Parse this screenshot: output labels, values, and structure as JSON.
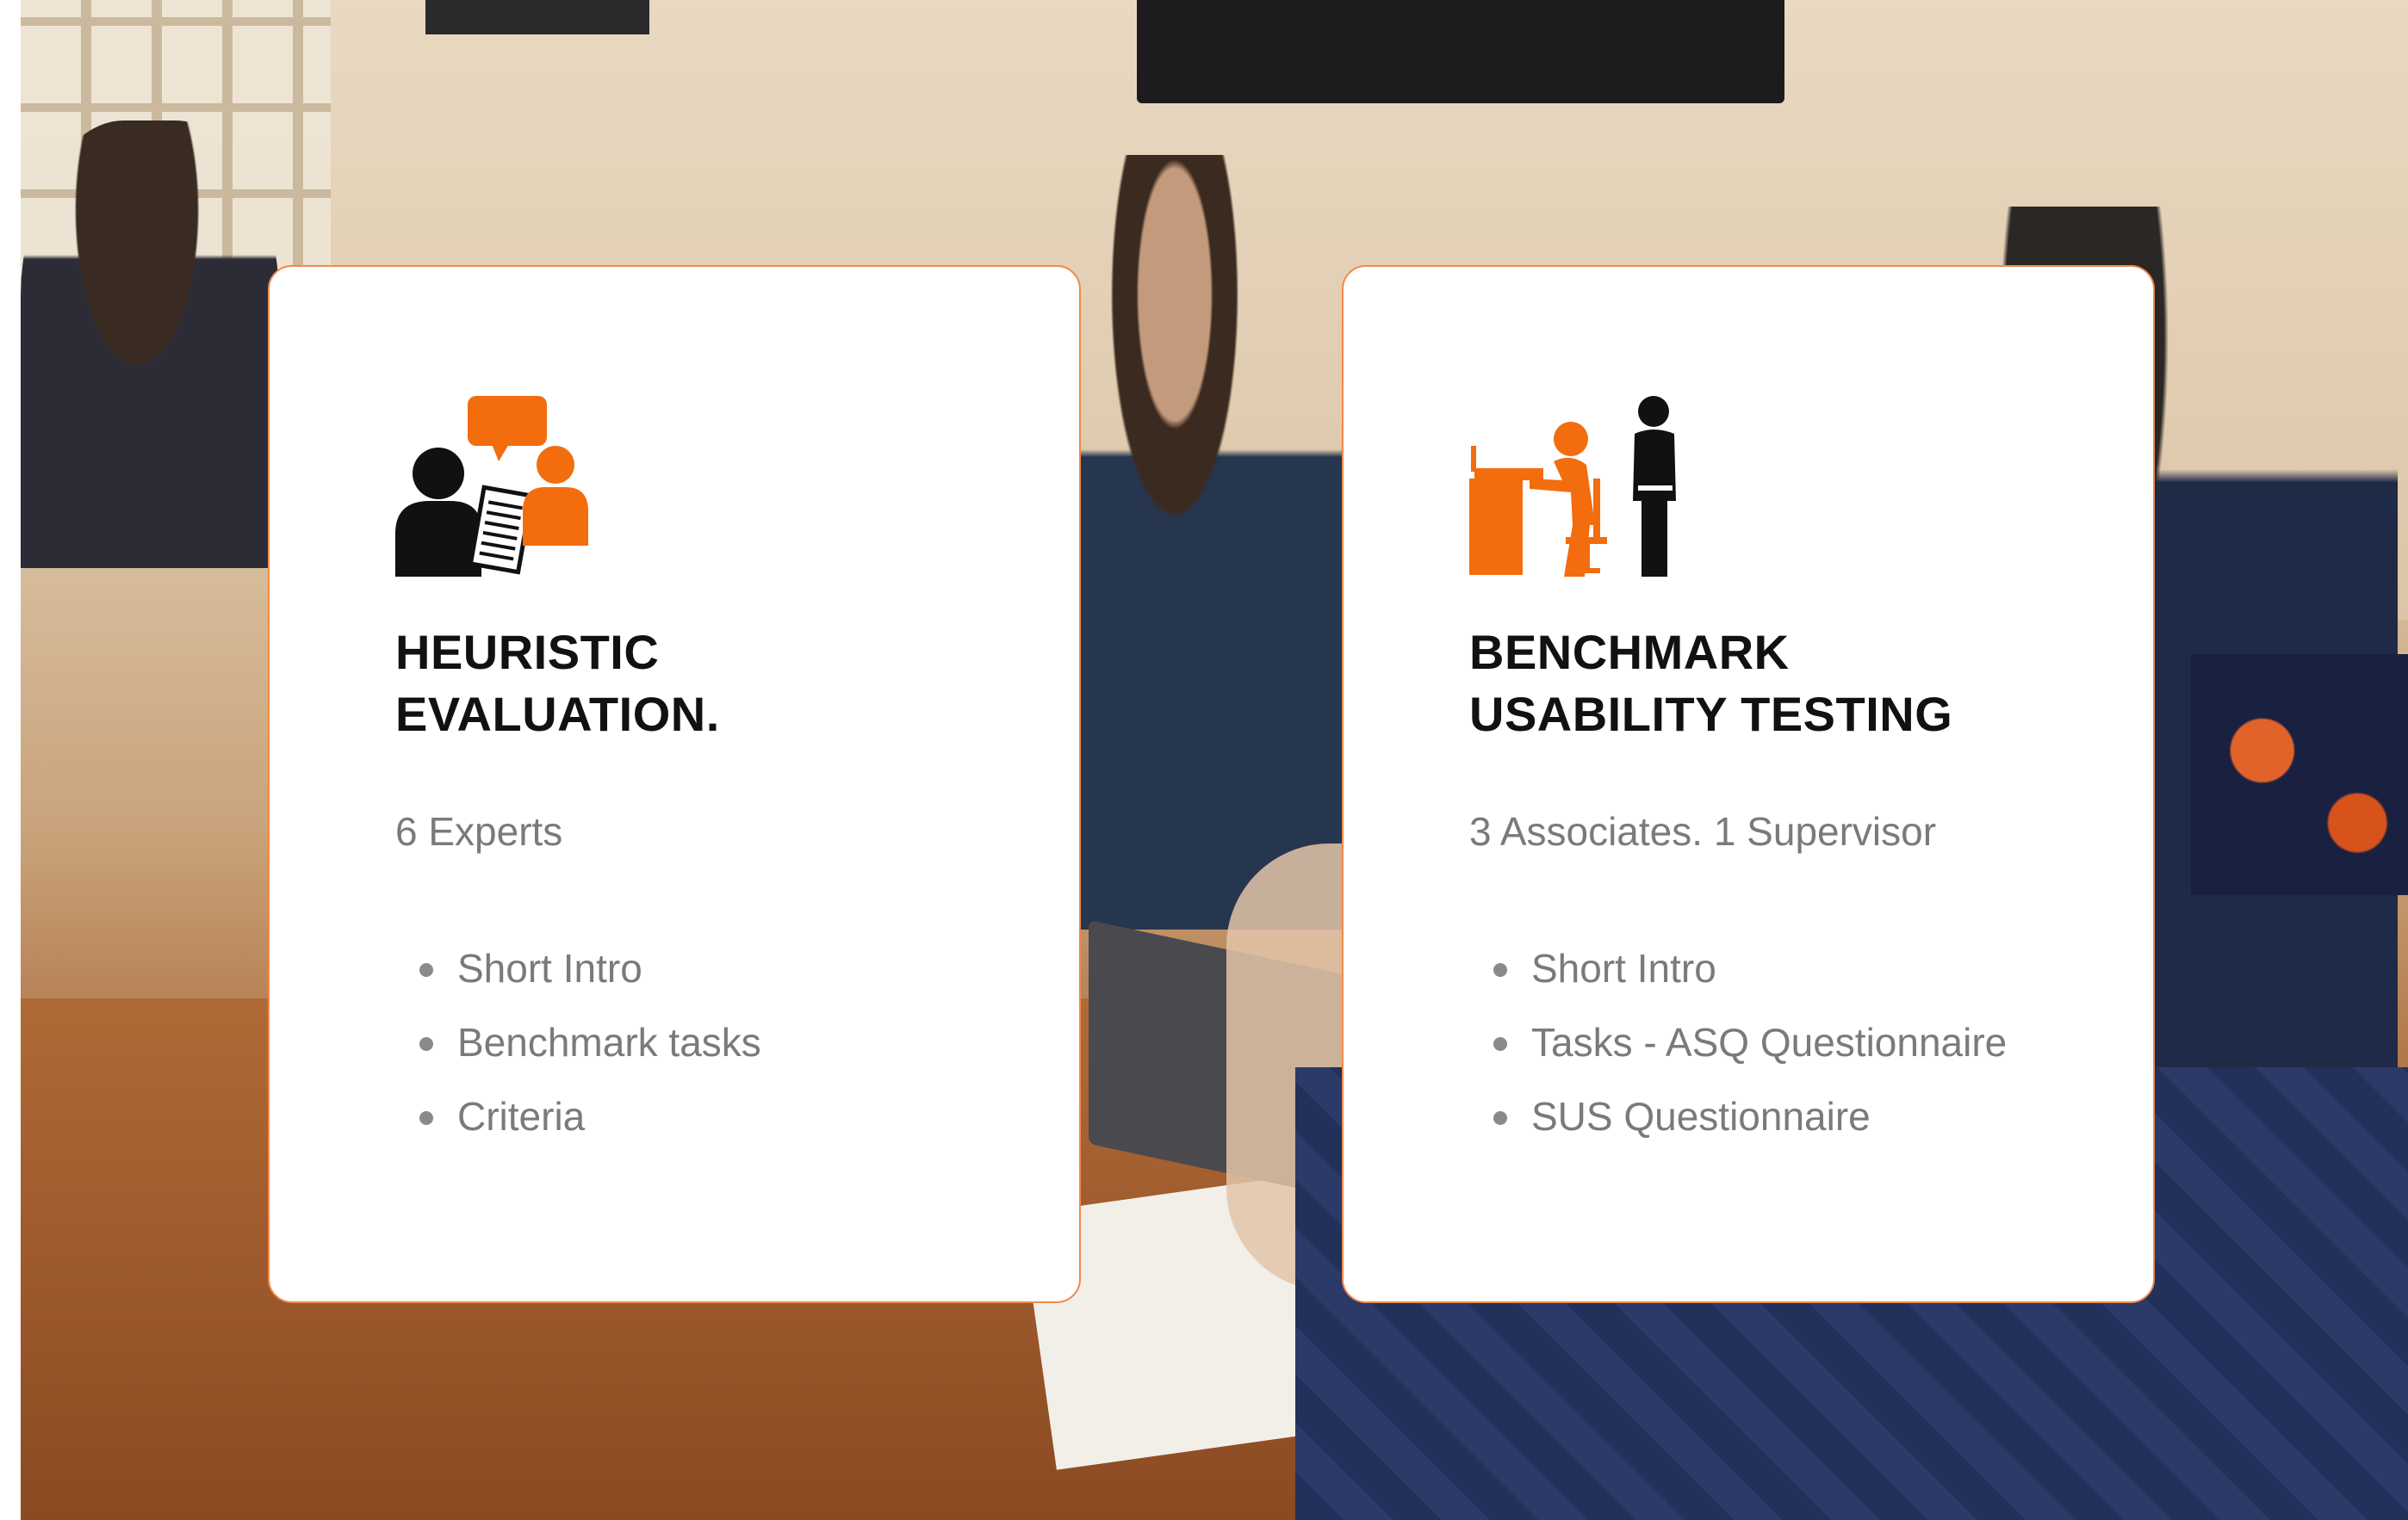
{
  "colors": {
    "accent": "#f36c0e",
    "card_border": "#f08a4b",
    "title": "#111111",
    "muted_text": "#7a7a7a",
    "card_background": "#ffffff"
  },
  "background": {
    "icon": "photo-of-usability-session"
  },
  "cards": [
    {
      "icon": "expert-review-icon",
      "title_line1": "HEURISTIC",
      "title_line2": "EVALUATION.",
      "subtitle": "6 Experts",
      "items": [
        "Short Intro",
        "Benchmark tasks",
        "Criteria"
      ]
    },
    {
      "icon": "usability-test-icon",
      "title_line1": "BENCHMARK",
      "title_line2": "USABILITY TESTING",
      "subtitle": "3 Associates. 1 Supervisor",
      "items": [
        "Short Intro",
        "Tasks - ASQ Questionnaire",
        "SUS Questionnaire"
      ]
    }
  ]
}
